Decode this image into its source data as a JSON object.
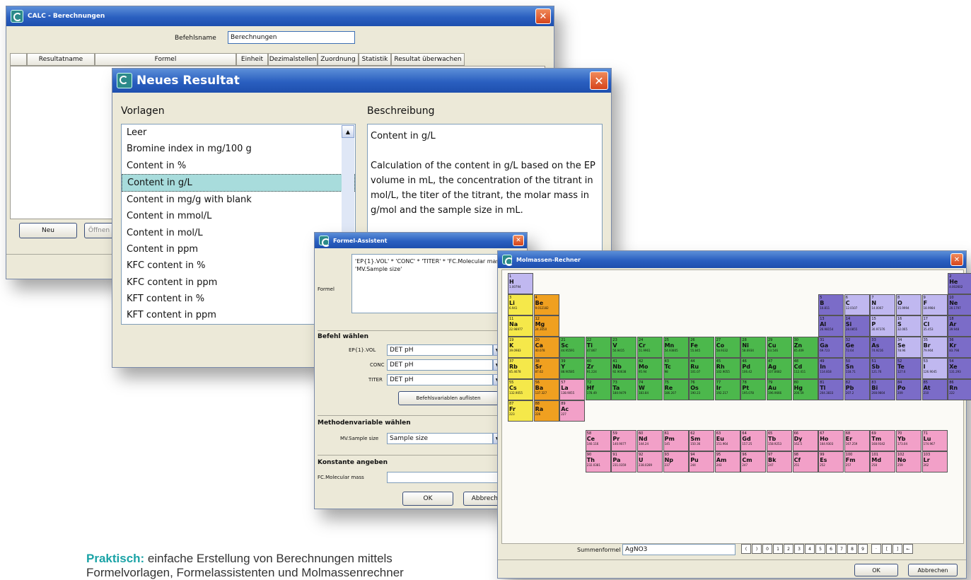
{
  "colors": {
    "accent": "#1aa3a6",
    "titlebar": "#2a5fc0",
    "selection": "#a8dcdc",
    "alkali": "#f5e84a",
    "alkaline": "#f0a020",
    "transition": "#4cb84c",
    "pblock": "#7b6cc8",
    "lanthanide": "#f2a0c8",
    "nonmetal": "#c0b8f0"
  },
  "w1": {
    "title": "CALC - Berechnungen",
    "name_label": "Befehlsname",
    "name_value": "Berechnungen",
    "columns": [
      "Resultatname",
      "Formel",
      "Einheit",
      "Dezimalstellen",
      "Zuordnung",
      "Statistik",
      "Resultat überwachen"
    ],
    "btn_new": "Neu",
    "btn_open": "Öffnen"
  },
  "w2": {
    "title": "Neues Resultat",
    "templates_header": "Vorlagen",
    "desc_header": "Beschreibung",
    "items": [
      "Leer",
      "Bromine index in mg/100 g",
      "Content in %",
      "Content in g/L",
      "Content in mg/g with blank",
      "Content in mmol/L",
      "Content in mol/L",
      "Content in ppm",
      "KFC content in %",
      "KFC content in ppm",
      "KFT content in %",
      "KFT content in ppm"
    ],
    "selected_index": 3,
    "desc_title": "Content in g/L",
    "desc_body": "Calculation of the content in g/L based on the EP volume in mL, the concentration of the titrant in mol/L, the titer of the titrant, the molar mass in g/mol and the sample size in mL."
  },
  "w3": {
    "title": "Formel-Assistent",
    "formel_label": "Formel",
    "formel_value": "'EP{1}.VOL' * 'CONC' * 'TITER' * 'FC.Molecular mass' / 'MV.Sample size'",
    "section_vars": "Befehl wählen",
    "vars": [
      {
        "label": "EP{1}.VOL",
        "value": "DET pH"
      },
      {
        "label": "CONC",
        "value": "DET pH"
      },
      {
        "label": "TITER",
        "value": "DET pH"
      }
    ],
    "btn_list": "Befehlsvariablen auflisten",
    "section_method": "Methodenvariable wählen",
    "method_label": "MV.Sample size",
    "method_value": "Sample size",
    "section_const": "Konstante angeben",
    "const_label": "FC.Molecular mass",
    "btn_ok": "OK",
    "btn_cancel": "Abbrechen"
  },
  "w4": {
    "title": "Molmassen-Rechner",
    "sum_label": "Summenformel",
    "sum_value": "AgNO3",
    "keys": [
      "(",
      ")",
      "0",
      "1",
      "2",
      "3",
      "4",
      "5",
      "6",
      "7",
      "8",
      "9"
    ],
    "keys2": [
      "·",
      "[",
      "]",
      "←"
    ],
    "btn_ok": "OK",
    "btn_cancel": "Abbrechen",
    "elements": [
      {
        "s": "H",
        "n": 1,
        "m": "1.00794",
        "c": "nonmetal",
        "p": 1,
        "g": 1
      },
      {
        "s": "He",
        "n": 2,
        "m": "4.002602",
        "c": "pblock",
        "p": 1,
        "g": 18
      },
      {
        "s": "Li",
        "n": 3,
        "m": "6.941",
        "c": "alkali",
        "p": 2,
        "g": 1
      },
      {
        "s": "Be",
        "n": 4,
        "m": "9.012182",
        "c": "alkaline",
        "p": 2,
        "g": 2
      },
      {
        "s": "B",
        "n": 5,
        "m": "10.811",
        "c": "pblock",
        "p": 2,
        "g": 13
      },
      {
        "s": "C",
        "n": 6,
        "m": "12.0107",
        "c": "nonmetal",
        "p": 2,
        "g": 14
      },
      {
        "s": "N",
        "n": 7,
        "m": "14.0067",
        "c": "nonmetal",
        "p": 2,
        "g": 15
      },
      {
        "s": "O",
        "n": 8,
        "m": "15.9994",
        "c": "nonmetal",
        "p": 2,
        "g": 16
      },
      {
        "s": "F",
        "n": 9,
        "m": "18.9984",
        "c": "nonmetal",
        "p": 2,
        "g": 17
      },
      {
        "s": "Ne",
        "n": 10,
        "m": "20.1797",
        "c": "pblock",
        "p": 2,
        "g": 18
      },
      {
        "s": "Na",
        "n": 11,
        "m": "22.98977",
        "c": "alkali",
        "p": 3,
        "g": 1
      },
      {
        "s": "Mg",
        "n": 12,
        "m": "24.3050",
        "c": "alkaline",
        "p": 3,
        "g": 2
      },
      {
        "s": "Al",
        "n": 13,
        "m": "26.98154",
        "c": "pblock",
        "p": 3,
        "g": 13
      },
      {
        "s": "Si",
        "n": 14,
        "m": "28.0855",
        "c": "pblock",
        "p": 3,
        "g": 14
      },
      {
        "s": "P",
        "n": 15,
        "m": "30.97376",
        "c": "nonmetal",
        "p": 3,
        "g": 15
      },
      {
        "s": "S",
        "n": 16,
        "m": "32.065",
        "c": "nonmetal",
        "p": 3,
        "g": 16
      },
      {
        "s": "Cl",
        "n": 17,
        "m": "35.453",
        "c": "nonmetal",
        "p": 3,
        "g": 17
      },
      {
        "s": "Ar",
        "n": 18,
        "m": "39.948",
        "c": "pblock",
        "p": 3,
        "g": 18
      },
      {
        "s": "K",
        "n": 19,
        "m": "39.0983",
        "c": "alkali",
        "p": 4,
        "g": 1
      },
      {
        "s": "Ca",
        "n": 20,
        "m": "40.078",
        "c": "alkaline",
        "p": 4,
        "g": 2
      },
      {
        "s": "Sc",
        "n": 21,
        "m": "44.95591",
        "c": "transition",
        "p": 4,
        "g": 3
      },
      {
        "s": "Ti",
        "n": 22,
        "m": "47.867",
        "c": "transition",
        "p": 4,
        "g": 4
      },
      {
        "s": "V",
        "n": 23,
        "m": "50.9415",
        "c": "transition",
        "p": 4,
        "g": 5
      },
      {
        "s": "Cr",
        "n": 24,
        "m": "51.9961",
        "c": "transition",
        "p": 4,
        "g": 6
      },
      {
        "s": "Mn",
        "n": 25,
        "m": "54.93805",
        "c": "transition",
        "p": 4,
        "g": 7
      },
      {
        "s": "Fe",
        "n": 26,
        "m": "55.845",
        "c": "transition",
        "p": 4,
        "g": 8
      },
      {
        "s": "Co",
        "n": 27,
        "m": "58.9332",
        "c": "transition",
        "p": 4,
        "g": 9
      },
      {
        "s": "Ni",
        "n": 28,
        "m": "58.6934",
        "c": "transition",
        "p": 4,
        "g": 10
      },
      {
        "s": "Cu",
        "n": 29,
        "m": "63.546",
        "c": "transition",
        "p": 4,
        "g": 11
      },
      {
        "s": "Zn",
        "n": 30,
        "m": "65.409",
        "c": "transition",
        "p": 4,
        "g": 12
      },
      {
        "s": "Ga",
        "n": 31,
        "m": "69.723",
        "c": "pblock",
        "p": 4,
        "g": 13
      },
      {
        "s": "Ge",
        "n": 32,
        "m": "72.64",
        "c": "pblock",
        "p": 4,
        "g": 14
      },
      {
        "s": "As",
        "n": 33,
        "m": "74.9216",
        "c": "pblock",
        "p": 4,
        "g": 15
      },
      {
        "s": "Se",
        "n": 34,
        "m": "78.96",
        "c": "nonmetal",
        "p": 4,
        "g": 16
      },
      {
        "s": "Br",
        "n": 35,
        "m": "79.904",
        "c": "nonmetal",
        "p": 4,
        "g": 17
      },
      {
        "s": "Kr",
        "n": 36,
        "m": "83.798",
        "c": "pblock",
        "p": 4,
        "g": 18
      },
      {
        "s": "Rb",
        "n": 37,
        "m": "85.4678",
        "c": "alkali",
        "p": 5,
        "g": 1
      },
      {
        "s": "Sr",
        "n": 38,
        "m": "87.62",
        "c": "alkaline",
        "p": 5,
        "g": 2
      },
      {
        "s": "Y",
        "n": 39,
        "m": "88.90585",
        "c": "transition",
        "p": 5,
        "g": 3
      },
      {
        "s": "Zr",
        "n": 40,
        "m": "91.224",
        "c": "transition",
        "p": 5,
        "g": 4
      },
      {
        "s": "Nb",
        "n": 41,
        "m": "92.90638",
        "c": "transition",
        "p": 5,
        "g": 5
      },
      {
        "s": "Mo",
        "n": 42,
        "m": "95.94",
        "c": "transition",
        "p": 5,
        "g": 6
      },
      {
        "s": "Tc",
        "n": 43,
        "m": "98",
        "c": "transition",
        "p": 5,
        "g": 7
      },
      {
        "s": "Ru",
        "n": 44,
        "m": "101.07",
        "c": "transition",
        "p": 5,
        "g": 8
      },
      {
        "s": "Rh",
        "n": 45,
        "m": "102.9055",
        "c": "transition",
        "p": 5,
        "g": 9
      },
      {
        "s": "Pd",
        "n": 46,
        "m": "106.42",
        "c": "transition",
        "p": 5,
        "g": 10
      },
      {
        "s": "Ag",
        "n": 47,
        "m": "107.8682",
        "c": "transition",
        "p": 5,
        "g": 11
      },
      {
        "s": "Cd",
        "n": 48,
        "m": "112.411",
        "c": "transition",
        "p": 5,
        "g": 12
      },
      {
        "s": "In",
        "n": 49,
        "m": "114.818",
        "c": "pblock",
        "p": 5,
        "g": 13
      },
      {
        "s": "Sn",
        "n": 50,
        "m": "118.71",
        "c": "pblock",
        "p": 5,
        "g": 14
      },
      {
        "s": "Sb",
        "n": 51,
        "m": "121.76",
        "c": "pblock",
        "p": 5,
        "g": 15
      },
      {
        "s": "Te",
        "n": 52,
        "m": "127.6",
        "c": "pblock",
        "p": 5,
        "g": 16
      },
      {
        "s": "I",
        "n": 53,
        "m": "126.9045",
        "c": "nonmetal",
        "p": 5,
        "g": 17
      },
      {
        "s": "Xe",
        "n": 54,
        "m": "131.293",
        "c": "pblock",
        "p": 5,
        "g": 18
      },
      {
        "s": "Cs",
        "n": 55,
        "m": "132.9055",
        "c": "alkali",
        "p": 6,
        "g": 1
      },
      {
        "s": "Ba",
        "n": 56,
        "m": "137.327",
        "c": "alkaline",
        "p": 6,
        "g": 2
      },
      {
        "s": "La",
        "n": 57,
        "m": "138.9055",
        "c": "lanthanide",
        "p": 6,
        "g": 3
      },
      {
        "s": "Hf",
        "n": 72,
        "m": "178.49",
        "c": "transition",
        "p": 6,
        "g": 4
      },
      {
        "s": "Ta",
        "n": 73,
        "m": "180.9479",
        "c": "transition",
        "p": 6,
        "g": 5
      },
      {
        "s": "W",
        "n": 74,
        "m": "183.84",
        "c": "transition",
        "p": 6,
        "g": 6
      },
      {
        "s": "Re",
        "n": 75,
        "m": "186.207",
        "c": "transition",
        "p": 6,
        "g": 7
      },
      {
        "s": "Os",
        "n": 76,
        "m": "190.23",
        "c": "transition",
        "p": 6,
        "g": 8
      },
      {
        "s": "Ir",
        "n": 77,
        "m": "192.217",
        "c": "transition",
        "p": 6,
        "g": 9
      },
      {
        "s": "Pt",
        "n": 78,
        "m": "195.078",
        "c": "transition",
        "p": 6,
        "g": 10
      },
      {
        "s": "Au",
        "n": 79,
        "m": "196.9666",
        "c": "transition",
        "p": 6,
        "g": 11
      },
      {
        "s": "Hg",
        "n": 80,
        "m": "200.59",
        "c": "transition",
        "p": 6,
        "g": 12
      },
      {
        "s": "Tl",
        "n": 81,
        "m": "204.3833",
        "c": "pblock",
        "p": 6,
        "g": 13
      },
      {
        "s": "Pb",
        "n": 82,
        "m": "207.2",
        "c": "pblock",
        "p": 6,
        "g": 14
      },
      {
        "s": "Bi",
        "n": 83,
        "m": "208.9804",
        "c": "pblock",
        "p": 6,
        "g": 15
      },
      {
        "s": "Po",
        "n": 84,
        "m": "209",
        "c": "pblock",
        "p": 6,
        "g": 16
      },
      {
        "s": "At",
        "n": 85,
        "m": "210",
        "c": "pblock",
        "p": 6,
        "g": 17
      },
      {
        "s": "Rn",
        "n": 86,
        "m": "222",
        "c": "pblock",
        "p": 6,
        "g": 18
      },
      {
        "s": "Fr",
        "n": 87,
        "m": "223",
        "c": "alkali",
        "p": 7,
        "g": 1
      },
      {
        "s": "Ra",
        "n": 88,
        "m": "226",
        "c": "alkaline",
        "p": 7,
        "g": 2
      },
      {
        "s": "Ac",
        "n": 89,
        "m": "227",
        "c": "lanthanide",
        "p": 7,
        "g": 3
      },
      {
        "s": "Ce",
        "n": 58,
        "m": "140.116",
        "c": "lanthanide",
        "p": 9,
        "g": 4
      },
      {
        "s": "Pr",
        "n": 59,
        "m": "140.9077",
        "c": "lanthanide",
        "p": 9,
        "g": 5
      },
      {
        "s": "Nd",
        "n": 60,
        "m": "144.24",
        "c": "lanthanide",
        "p": 9,
        "g": 6
      },
      {
        "s": "Pm",
        "n": 61,
        "m": "145",
        "c": "lanthanide",
        "p": 9,
        "g": 7
      },
      {
        "s": "Sm",
        "n": 62,
        "m": "150.36",
        "c": "lanthanide",
        "p": 9,
        "g": 8
      },
      {
        "s": "Eu",
        "n": 63,
        "m": "151.964",
        "c": "lanthanide",
        "p": 9,
        "g": 9
      },
      {
        "s": "Gd",
        "n": 64,
        "m": "157.25",
        "c": "lanthanide",
        "p": 9,
        "g": 10
      },
      {
        "s": "Tb",
        "n": 65,
        "m": "158.9253",
        "c": "lanthanide",
        "p": 9,
        "g": 11
      },
      {
        "s": "Dy",
        "n": 66,
        "m": "162.5",
        "c": "lanthanide",
        "p": 9,
        "g": 12
      },
      {
        "s": "Ho",
        "n": 67,
        "m": "164.9303",
        "c": "lanthanide",
        "p": 9,
        "g": 13
      },
      {
        "s": "Er",
        "n": 68,
        "m": "167.259",
        "c": "lanthanide",
        "p": 9,
        "g": 14
      },
      {
        "s": "Tm",
        "n": 69,
        "m": "168.9342",
        "c": "lanthanide",
        "p": 9,
        "g": 15
      },
      {
        "s": "Yb",
        "n": 70,
        "m": "173.04",
        "c": "lanthanide",
        "p": 9,
        "g": 16
      },
      {
        "s": "Lu",
        "n": 71,
        "m": "174.967",
        "c": "lanthanide",
        "p": 9,
        "g": 17
      },
      {
        "s": "Th",
        "n": 90,
        "m": "232.0381",
        "c": "lanthanide",
        "p": 10,
        "g": 4
      },
      {
        "s": "Pa",
        "n": 91,
        "m": "231.0359",
        "c": "lanthanide",
        "p": 10,
        "g": 5
      },
      {
        "s": "U",
        "n": 92,
        "m": "238.0289",
        "c": "lanthanide",
        "p": 10,
        "g": 6
      },
      {
        "s": "Np",
        "n": 93,
        "m": "237",
        "c": "lanthanide",
        "p": 10,
        "g": 7
      },
      {
        "s": "Pu",
        "n": 94,
        "m": "244",
        "c": "lanthanide",
        "p": 10,
        "g": 8
      },
      {
        "s": "Am",
        "n": 95,
        "m": "243",
        "c": "lanthanide",
        "p": 10,
        "g": 9
      },
      {
        "s": "Cm",
        "n": 96,
        "m": "247",
        "c": "lanthanide",
        "p": 10,
        "g": 10
      },
      {
        "s": "Bk",
        "n": 97,
        "m": "247",
        "c": "lanthanide",
        "p": 10,
        "g": 11
      },
      {
        "s": "Cf",
        "n": 98,
        "m": "251",
        "c": "lanthanide",
        "p": 10,
        "g": 12
      },
      {
        "s": "Es",
        "n": 99,
        "m": "252",
        "c": "lanthanide",
        "p": 10,
        "g": 13
      },
      {
        "s": "Fm",
        "n": 100,
        "m": "257",
        "c": "lanthanide",
        "p": 10,
        "g": 14
      },
      {
        "s": "Md",
        "n": 101,
        "m": "258",
        "c": "lanthanide",
        "p": 10,
        "g": 15
      },
      {
        "s": "No",
        "n": 102,
        "m": "259",
        "c": "lanthanide",
        "p": 10,
        "g": 16
      },
      {
        "s": "Lr",
        "n": 103,
        "m": "262",
        "c": "lanthanide",
        "p": 10,
        "g": 17
      }
    ]
  },
  "caption": {
    "strong": "Praktisch:",
    "line1": " einfache Erstellung von Berechnungen mittels",
    "line2": "Formelvorlagen, Formelassistenten und Molmassenrechner"
  }
}
